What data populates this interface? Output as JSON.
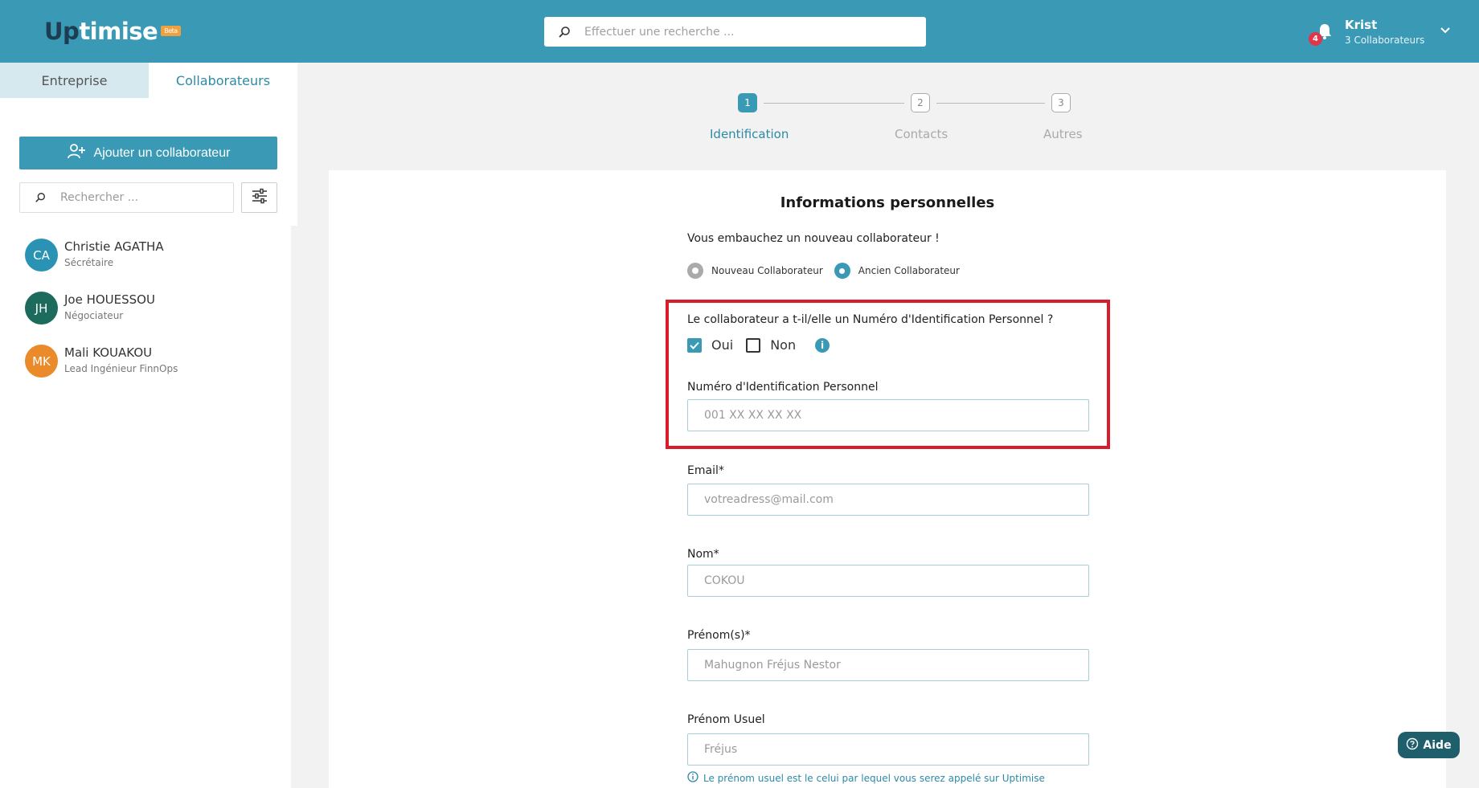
{
  "header": {
    "logo_up": "Up",
    "logo_rest": "timise",
    "logo_badge": "Beta",
    "search_placeholder": "Effectuer une recherche ...",
    "notifications_count": "4",
    "user_name": "Krist",
    "user_sub": "3 Collaborateurs"
  },
  "sidebar": {
    "tabs": [
      {
        "label": "Entreprise"
      },
      {
        "label": "Collaborateurs"
      }
    ],
    "add_label": "Ajouter un collaborateur",
    "search_placeholder": "Rechercher ...",
    "people": [
      {
        "initials": "CA",
        "name": "Christie AGATHA",
        "role": "Sécrétaire",
        "color": "#2a93b3"
      },
      {
        "initials": "JH",
        "name": "Joe HOUESSOU",
        "role": "Négociateur",
        "color": "#1d6b5c"
      },
      {
        "initials": "MK",
        "name": "Mali KOUAKOU",
        "role": "Lead Ingénieur FinnOps",
        "color": "#ea8a2a"
      }
    ]
  },
  "stepper": {
    "steps": [
      {
        "num": "1",
        "label": "Identification"
      },
      {
        "num": "2",
        "label": "Contacts"
      },
      {
        "num": "3",
        "label": "Autres"
      }
    ]
  },
  "form": {
    "title": "Informations personnelles",
    "hire_question": "Vous embauchez un nouveau collaborateur !",
    "radio_new": "Nouveau Collaborateur",
    "radio_old": "Ancien Collaborateur",
    "nip_question": "Le collaborateur a t-il/elle un Numéro d'Identification Personnel ?",
    "yes": "Oui",
    "no": "Non",
    "nip_label": "Numéro d'Identification Personnel",
    "nip_placeholder": "001 XX XX XX XX",
    "email_label": "Email*",
    "email_placeholder": "votreadress@mail.com",
    "nom_label": "Nom*",
    "nom_placeholder": "COKOU",
    "prenom_label": "Prénom(s)*",
    "prenom_placeholder": "Mahugnon Fréjus Nestor",
    "usuel_label": "Prénom Usuel",
    "usuel_placeholder": "Fréjus",
    "usuel_hint": "Le prénom usuel est le celui par lequel vous serez appelé sur Uptimise"
  },
  "help": {
    "label": "Aide"
  },
  "colors": {
    "accent": "#3a9ab5",
    "highlight": "#d91c2a"
  }
}
